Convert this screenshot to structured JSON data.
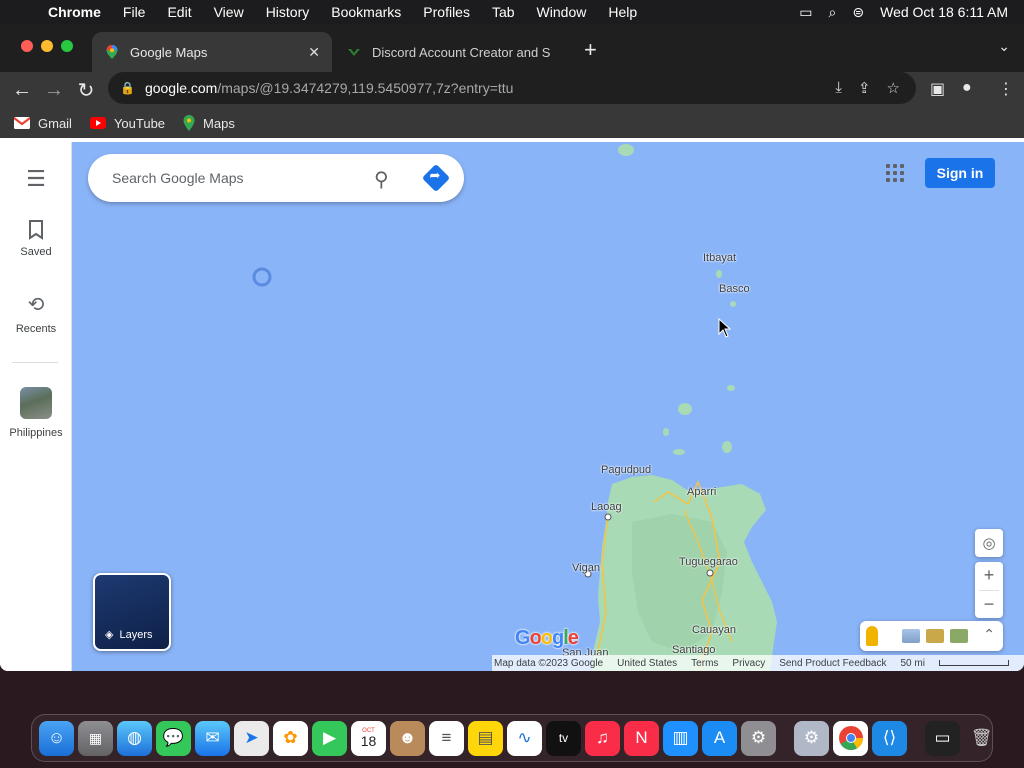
{
  "menubar": {
    "app": "Chrome",
    "items": [
      "File",
      "Edit",
      "View",
      "History",
      "Bookmarks",
      "Profiles",
      "Tab",
      "Window",
      "Help"
    ],
    "datetime": "Wed Oct 18  6:11 AM"
  },
  "tabs": [
    {
      "title": "Google Maps"
    },
    {
      "title": "Discord Account Creator and S"
    }
  ],
  "omnibox": {
    "host": "google.com",
    "path": "/maps/@19.3474279,119.5450977,7z?entry=ttu"
  },
  "bookmarks": [
    "Gmail",
    "YouTube",
    "Maps"
  ],
  "sidebar": {
    "saved": "Saved",
    "recents": "Recents",
    "place": "Philippines"
  },
  "search": {
    "placeholder": "Search Google Maps"
  },
  "signin": "Sign in",
  "map_labels": {
    "itbayat": "Itbayat",
    "basco": "Basco",
    "pagudpud": "Pagudpud",
    "aparri": "Aparri",
    "laoag": "Laoag",
    "vigan": "Vigan",
    "tuguegarao": "Tuguegarao",
    "cauayan": "Cauayan",
    "santiago": "Santiago",
    "sanjuan": "San Juan"
  },
  "layers_label": "Layers",
  "attribution": {
    "data": "Map data ©2023 Google",
    "country": "United States",
    "terms": "Terms",
    "privacy": "Privacy",
    "feedback": "Send Product Feedback",
    "scale": "50 mi"
  },
  "google_logo": "Google",
  "colors": {
    "water": "#8ab4f8",
    "land": "#a8dab5",
    "accent": "#1a73e8"
  }
}
